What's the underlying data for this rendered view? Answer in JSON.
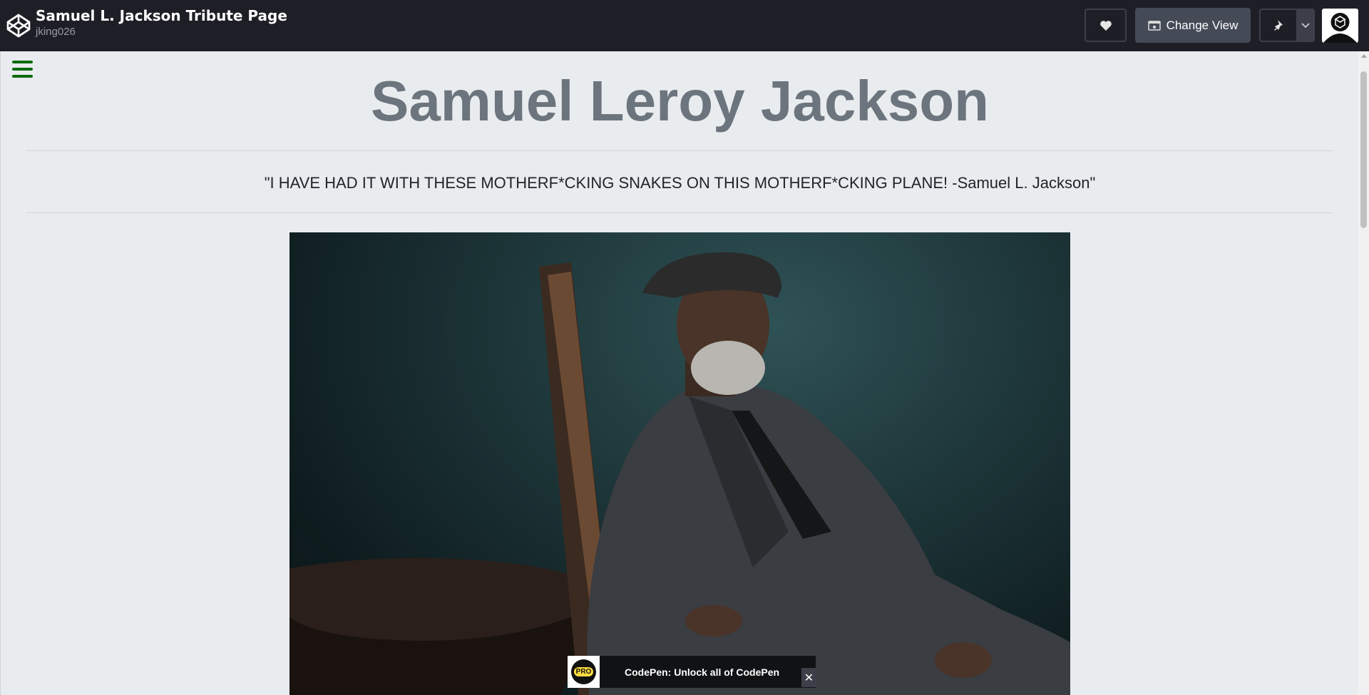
{
  "header": {
    "pen_title": "Samuel L. Jackson Tribute Page",
    "username": "jking026",
    "change_view_label": "Change View"
  },
  "page": {
    "main_title": "Samuel Leroy Jackson",
    "quote": "\"I HAVE HAD IT WITH THESE MOTHERF*CKING SNAKES ON THIS MOTHERF*CKING PLANE! -Samuel L. Jackson\""
  },
  "toast": {
    "badge": "PRO",
    "text": "CodePen: Unlock all of CodePen",
    "close": "✕"
  },
  "icons": [
    "codepen-logo-icon",
    "heart-icon",
    "change-view-icon",
    "pin-icon",
    "chevron-down-icon",
    "hamburger-menu-icon",
    "close-icon"
  ],
  "colors": {
    "topbar": "#1e1f26",
    "preview_bg": "#e9ecef",
    "title_gray": "#6c757d",
    "hamburger_green": "#0a6b0a",
    "pro_yellow": "#ffdd40"
  }
}
